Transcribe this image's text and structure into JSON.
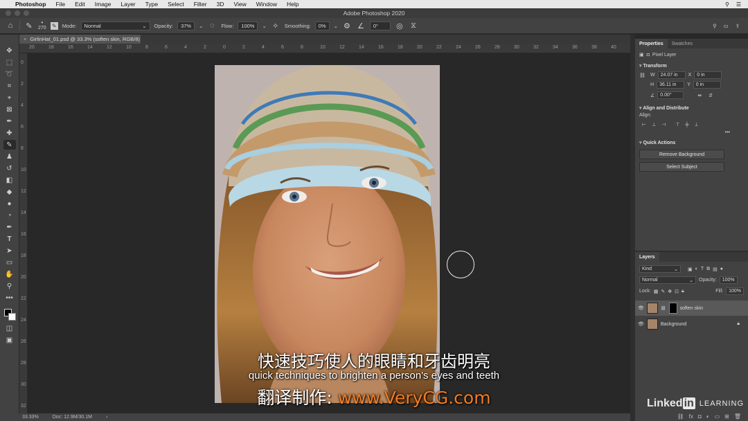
{
  "menubar": {
    "app": "Photoshop",
    "items": [
      "File",
      "Edit",
      "Image",
      "Layer",
      "Type",
      "Select",
      "Filter",
      "3D",
      "View",
      "Window",
      "Help"
    ]
  },
  "window": {
    "title": "Adobe Photoshop 2020"
  },
  "options": {
    "brush_size": "270",
    "mode_label": "Mode:",
    "mode_value": "Normal",
    "opacity_label": "Opacity:",
    "opacity_value": "37%",
    "flow_label": "Flow:",
    "flow_value": "100%",
    "smoothing_label": "Smoothing:",
    "smoothing_value": "0%",
    "angle_value": "0°"
  },
  "document": {
    "tab": "GirlinHat_01.psd @ 33.3% (soften skin, RGB/8)"
  },
  "ruler": {
    "h": [
      "20",
      "18",
      "16",
      "14",
      "12",
      "10",
      "8",
      "6",
      "4",
      "2",
      "0",
      "2",
      "4",
      "6",
      "8",
      "10",
      "12",
      "14",
      "16",
      "18",
      "20",
      "22",
      "24",
      "26",
      "28",
      "30",
      "32",
      "34",
      "36",
      "38",
      "40",
      "42"
    ],
    "v": [
      "0",
      "2",
      "4",
      "6",
      "8",
      "10",
      "12",
      "14",
      "16",
      "18",
      "20",
      "22",
      "24",
      "26",
      "28",
      "30",
      "32"
    ]
  },
  "status": {
    "zoom": "33.33%",
    "doc": "Doc: 12.9M/30.1M"
  },
  "properties": {
    "tabs": [
      "Properties",
      "Swatches"
    ],
    "layer_type": "Pixel Layer",
    "transform_title": "Transform",
    "w_label": "W",
    "w_value": "24.07 in",
    "h_label": "H",
    "h_value": "36.11 in",
    "x_label": "X",
    "x_value": "0 in",
    "y_label": "Y",
    "y_value": "0 in",
    "angle_value": "0.00°",
    "align_title": "Align and Distribute",
    "align_label": "Align:",
    "quick_title": "Quick Actions",
    "remove_bg": "Remove Background",
    "select_subject": "Select Subject"
  },
  "layers": {
    "tab": "Layers",
    "kind": "Kind",
    "blend": "Normal",
    "opacity_label": "Opacity:",
    "opacity_value": "100%",
    "lock_label": "Lock:",
    "fill_label": "Fill:",
    "fill_value": "100%",
    "items": [
      {
        "name": "soften skin"
      },
      {
        "name": "Background"
      }
    ]
  },
  "subtitles": {
    "line1": "快速技巧使人的眼睛和牙齿明亮",
    "line2": "quick techniques to brighten a person's eyes and teeth",
    "line3_prefix": "翻译制作: ",
    "line3_url": "www.VeryCG.com"
  },
  "watermark": {
    "brand_a": "Linked",
    "brand_b": "in",
    "brand_c": "LEARNING"
  }
}
